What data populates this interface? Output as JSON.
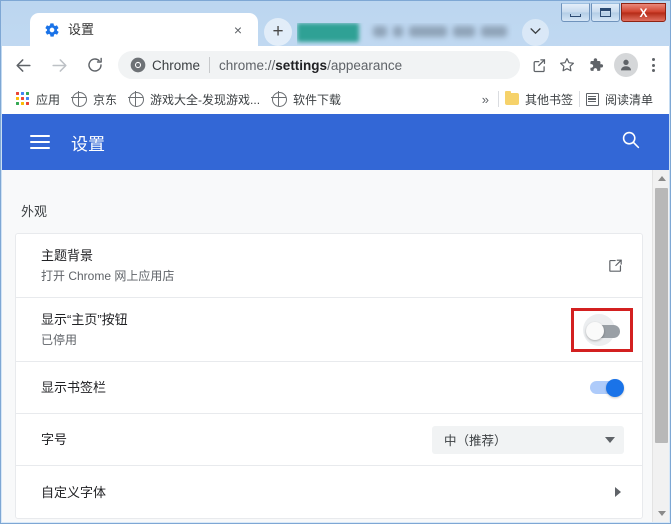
{
  "window": {
    "controls": {
      "minimize": "–",
      "maximize": "□",
      "close": "X"
    }
  },
  "tabstrip": {
    "active_tab": {
      "title": "设置",
      "favicon": "settings-gear-icon",
      "close_label": "×"
    },
    "new_tab_label": "+",
    "tab_search_label": "⌄",
    "obscured_tab_note": ""
  },
  "toolbar": {
    "back_icon": "←",
    "forward_icon": "→",
    "reload_icon": "⟳",
    "omnibox": {
      "scheme_label": "Chrome",
      "url_prefix": "chrome://",
      "url_bold": "settings",
      "url_suffix": "/appearance",
      "full_url": "chrome://settings/appearance"
    },
    "share_icon": "share-icon",
    "bookmark_star_icon": "star-icon",
    "extensions_icon": "puzzle-icon",
    "profile_icon": "person-icon",
    "menu_icon": "three-dots-icon"
  },
  "bookmarks": {
    "items": [
      {
        "label": "应用",
        "icon": "apps-grid-icon"
      },
      {
        "label": "京东",
        "icon": "globe-icon"
      },
      {
        "label": "游戏大全-发现游戏...",
        "icon": "globe-icon"
      },
      {
        "label": "软件下载",
        "icon": "globe-icon"
      }
    ],
    "overflow_label": "»",
    "other_bookmarks": {
      "label": "其他书签",
      "icon": "folder-icon"
    },
    "reading_list": {
      "label": "阅读清单",
      "icon": "reading-list-icon"
    }
  },
  "settings_header": {
    "menu_icon": "hamburger-icon",
    "title": "设置",
    "search_icon": "search-icon",
    "background_color": "#3367d6"
  },
  "content": {
    "section_label": "外观",
    "rows": [
      {
        "title": "主题背景",
        "subtitle": "打开 Chrome 网上应用店",
        "control": "external-link",
        "control_icon": "open-in-new-icon"
      },
      {
        "title": "显示“主页”按钮",
        "subtitle": "已停用",
        "control": "toggle",
        "toggle_state": "off",
        "highlighted": true,
        "highlight_color": "#d32020"
      },
      {
        "title": "显示书签栏",
        "subtitle": "",
        "control": "toggle",
        "toggle_state": "on",
        "accent_color": "#1a73e8"
      },
      {
        "title": "字号",
        "subtitle": "",
        "control": "select",
        "select_value": "中（推荐）"
      },
      {
        "title": "自定义字体",
        "subtitle": "",
        "control": "submenu",
        "control_icon": "chevron-right-icon"
      }
    ]
  },
  "scrollbar": {
    "up_arrow": "▲",
    "down_arrow": "▼"
  }
}
